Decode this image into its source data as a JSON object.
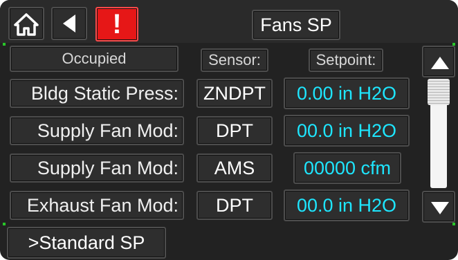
{
  "header": {
    "title": "Fans SP",
    "alert_glyph": "!",
    "icons": [
      "home-icon",
      "back-arrow-icon",
      "alarm-icon"
    ]
  },
  "columns": {
    "mode": "Occupied",
    "sensor": "Sensor:",
    "setpoint": "Setpoint:"
  },
  "rows": [
    {
      "label": "Bldg Static Press:",
      "sensor": "ZNDPT",
      "value": "0.00 in H2O"
    },
    {
      "label": "Supply Fan Mod:",
      "sensor": "DPT",
      "value": "00.0 in H2O"
    },
    {
      "label": "Supply Fan Mod:",
      "sensor": "AMS",
      "value": "00000 cfm"
    },
    {
      "label": "Exhaust Fan Mod:",
      "sensor": "DPT",
      "value": "00.0 in H2O"
    }
  ],
  "footer": {
    "standard_sp": ">Standard SP"
  },
  "scrollbar": {
    "up_icon": "up-arrow-icon",
    "down_icon": "down-arrow-icon"
  },
  "colors": {
    "background": "#222222",
    "value_text": "#1ee6ff",
    "alarm_red": "#e61717",
    "text": "#ffffff"
  }
}
